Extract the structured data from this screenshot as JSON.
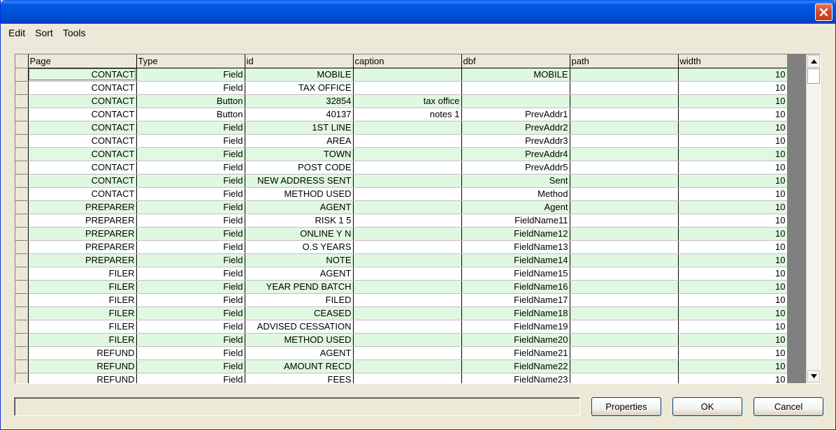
{
  "menu": [
    "Edit",
    "Sort",
    "Tools"
  ],
  "grid": {
    "columns": [
      "Page",
      "Type",
      "id",
      "caption",
      "dbf",
      "path",
      "width"
    ],
    "rows": [
      [
        "CONTACT",
        "Field",
        "MOBILE",
        "",
        "MOBILE",
        "",
        "10"
      ],
      [
        "CONTACT",
        "Field",
        "TAX OFFICE",
        "",
        "",
        "",
        "10"
      ],
      [
        "CONTACT",
        "Button",
        "32854",
        "tax office",
        "",
        "",
        "10"
      ],
      [
        "CONTACT",
        "Button",
        "40137",
        "notes 1",
        "PrevAddr1",
        "",
        "10"
      ],
      [
        "CONTACT",
        "Field",
        "1ST LINE",
        "",
        "PrevAddr2",
        "",
        "10"
      ],
      [
        "CONTACT",
        "Field",
        "AREA",
        "",
        "PrevAddr3",
        "",
        "10"
      ],
      [
        "CONTACT",
        "Field",
        "TOWN",
        "",
        "PrevAddr4",
        "",
        "10"
      ],
      [
        "CONTACT",
        "Field",
        "POST CODE",
        "",
        "PrevAddr5",
        "",
        "10"
      ],
      [
        "CONTACT",
        "Field",
        "NEW ADDRESS SENT",
        "",
        "Sent",
        "",
        "10"
      ],
      [
        "CONTACT",
        "Field",
        "METHOD USED",
        "",
        "Method",
        "",
        "10"
      ],
      [
        "PREPARER",
        "Field",
        "AGENT",
        "",
        "Agent",
        "",
        "10"
      ],
      [
        "PREPARER",
        "Field",
        "RISK 1 5",
        "",
        "FieldName11",
        "",
        "10"
      ],
      [
        "PREPARER",
        "Field",
        "ONLINE Y N",
        "",
        "FieldName12",
        "",
        "10"
      ],
      [
        "PREPARER",
        "Field",
        "O.S YEARS",
        "",
        "FieldName13",
        "",
        "10"
      ],
      [
        "PREPARER",
        "Field",
        "NOTE",
        "",
        "FieldName14",
        "",
        "10"
      ],
      [
        "FILER",
        "Field",
        "AGENT",
        "",
        "FieldName15",
        "",
        "10"
      ],
      [
        "FILER",
        "Field",
        "YEAR PEND BATCH",
        "",
        "FieldName16",
        "",
        "10"
      ],
      [
        "FILER",
        "Field",
        "FILED",
        "",
        "FieldName17",
        "",
        "10"
      ],
      [
        "FILER",
        "Field",
        "CEASED",
        "",
        "FieldName18",
        "",
        "10"
      ],
      [
        "FILER",
        "Field",
        "ADVISED CESSATION",
        "",
        "FieldName19",
        "",
        "10"
      ],
      [
        "FILER",
        "Field",
        "METHOD USED",
        "",
        "FieldName20",
        "",
        "10"
      ],
      [
        "REFUND",
        "Field",
        "AGENT",
        "",
        "FieldName21",
        "",
        "10"
      ],
      [
        "REFUND",
        "Field",
        "AMOUNT RECD",
        "",
        "FieldName22",
        "",
        "10"
      ],
      [
        "REFUND",
        "Field",
        "FEES",
        "",
        "FieldName23",
        "",
        "10"
      ]
    ]
  },
  "status_text": "",
  "buttons": {
    "properties": "Properties",
    "ok": "OK",
    "cancel": "Cancel"
  },
  "colors": {
    "row_alt": "#e0f8e0",
    "titlebar": "#0054e3"
  }
}
